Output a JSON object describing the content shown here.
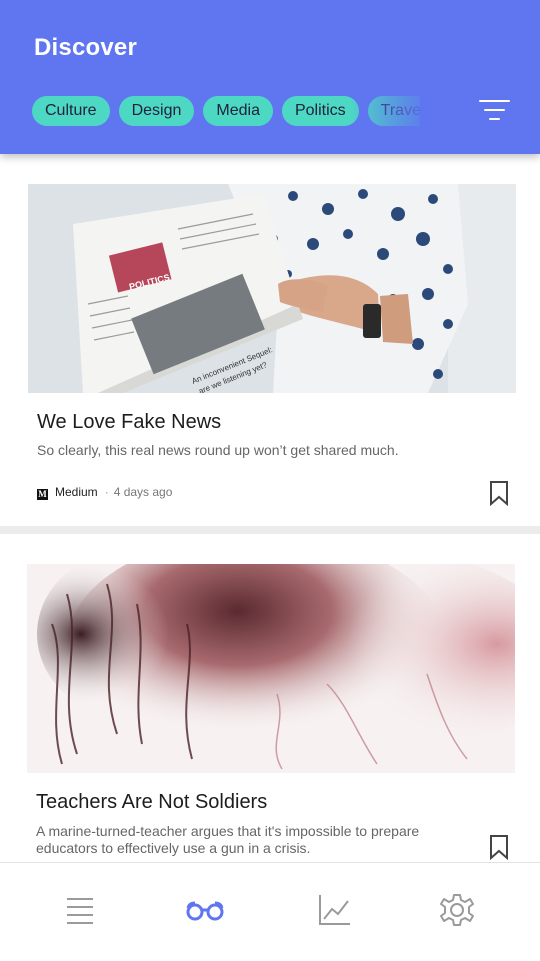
{
  "header": {
    "title": "Discover",
    "categories": [
      "Culture",
      "Design",
      "Media",
      "Politics",
      "Travel"
    ]
  },
  "articles": [
    {
      "title": "We Love Fake News",
      "description": "So clearly, this real news round up won’t get shared much.",
      "source": "Medium",
      "source_logo": "M",
      "time": "4 days ago",
      "image_print": [
        "POLITICS",
        "An inconvenient Sequel:",
        "are we listening yet?"
      ]
    },
    {
      "title": "Teachers Are Not Soldiers",
      "description": "A marine-turned-teacher argues that it's impossible to prepare educators to effectively use a gun in a crisis."
    }
  ],
  "nav": {
    "items": [
      "list-icon",
      "binoculars-icon",
      "chart-icon",
      "gear-icon"
    ],
    "active": "binoculars-icon"
  },
  "colors": {
    "header_bg": "#5f76f0",
    "chip_bg": "#4dd8c4",
    "active_nav": "#5f76f0",
    "inactive_nav": "#9a9a9a"
  }
}
